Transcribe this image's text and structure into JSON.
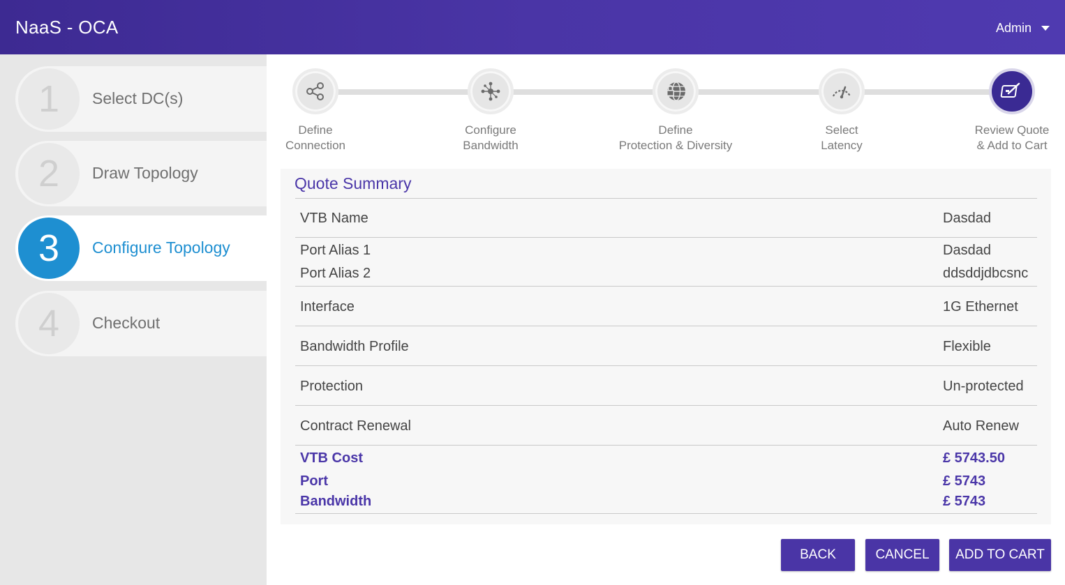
{
  "header": {
    "title": "NaaS - OCA",
    "user": "Admin"
  },
  "sidebar": {
    "items": [
      {
        "number": "1",
        "label": "Select DC(s)"
      },
      {
        "number": "2",
        "label": "Draw Topology"
      },
      {
        "number": "3",
        "label": "Configure Topology",
        "active": true
      },
      {
        "number": "4",
        "label": "Checkout"
      }
    ]
  },
  "wizard": {
    "steps": [
      {
        "line1": "Define",
        "line2": "Connection",
        "icon": "share-icon"
      },
      {
        "line1": "Configure",
        "line2": "Bandwidth",
        "icon": "network-icon"
      },
      {
        "line1": "Define",
        "line2": "Protection & Diversity",
        "icon": "globe-lock-icon"
      },
      {
        "line1": "Select",
        "line2": "Latency",
        "icon": "gauge-icon"
      },
      {
        "line1": "Review Quote",
        "line2": "& Add to Cart",
        "icon": "edit-icon",
        "active": true
      }
    ]
  },
  "summary": {
    "title": "Quote Summary",
    "vtb_name": {
      "label": "VTB Name",
      "value": "Dasdad"
    },
    "port_alias_1": {
      "label": "Port Alias 1",
      "value": "Dasdad"
    },
    "port_alias_2": {
      "label": "Port Alias 2",
      "value": "ddsddjdbcsnc"
    },
    "interface": {
      "label": "Interface",
      "value": "1G Ethernet"
    },
    "bandwidth_profile": {
      "label": "Bandwidth Profile",
      "value": "Flexible"
    },
    "protection": {
      "label": "Protection",
      "value": "Un-protected"
    },
    "contract_renewal": {
      "label": "Contract Renewal",
      "value": "Auto Renew"
    },
    "vtb_cost": {
      "label": "VTB Cost",
      "value": "£ 5743.50"
    },
    "port_cost": {
      "label": "Port",
      "value": "£ 5743"
    },
    "bandwidth_cost": {
      "label": "Bandwidth",
      "value": "£ 5743"
    }
  },
  "actions": {
    "back": "BACK",
    "cancel": "CANCEL",
    "add_to_cart": "ADD TO CART"
  },
  "colors": {
    "header": "#4a35a6",
    "accent_blue": "#1e8fd1",
    "accent_purple": "#4a36a8"
  }
}
